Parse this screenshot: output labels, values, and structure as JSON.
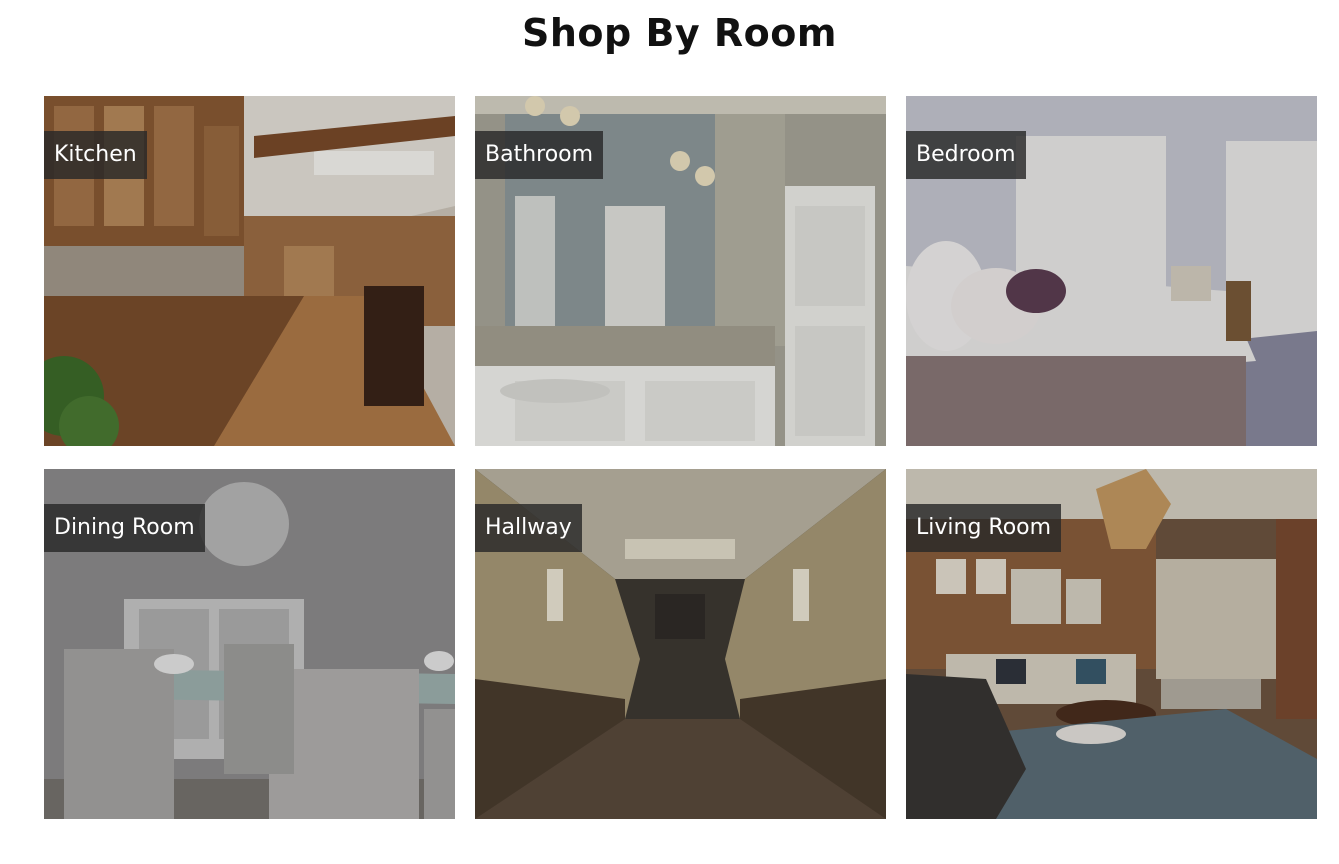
{
  "section": {
    "title": "Shop By Room"
  },
  "rooms": [
    {
      "label": "Kitchen"
    },
    {
      "label": "Bathroom"
    },
    {
      "label": "Bedroom"
    },
    {
      "label": "Dining Room"
    },
    {
      "label": "Hallway"
    },
    {
      "label": "Living Room"
    }
  ]
}
